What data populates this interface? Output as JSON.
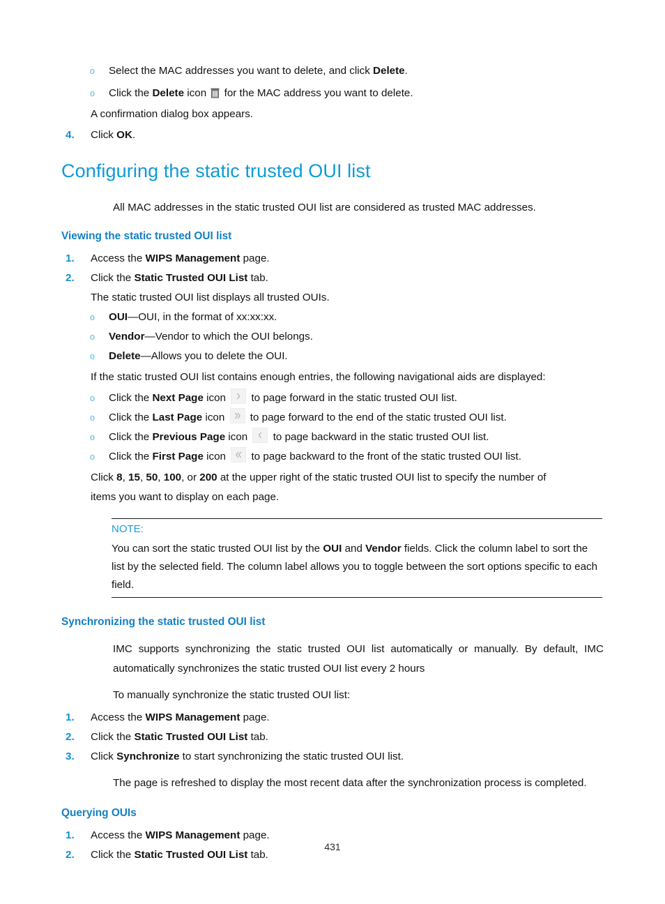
{
  "document": {
    "page_number": "431"
  },
  "top_section": {
    "bullets": [
      {
        "marker": "o",
        "pre": "Select the MAC addresses you want to delete, and click ",
        "bold": "Delete",
        "post": "."
      },
      {
        "marker": "o",
        "pre": "Click the ",
        "bold": "Delete",
        "mid": " icon ",
        "icon": "trash-icon",
        "post": " for the MAC address you want to delete."
      }
    ],
    "confirmation_text": "A confirmation dialog box appears.",
    "step": {
      "num": "4.",
      "pre": "Click ",
      "bold": "OK",
      "post": "."
    }
  },
  "main_heading": "Configuring the static trusted OUI list",
  "intro_paragraph": "All MAC addresses in the static trusted OUI list are considered as trusted MAC addresses.",
  "viewing": {
    "heading": "Viewing the static trusted OUI list",
    "steps": [
      {
        "num": "1.",
        "pre": "Access the ",
        "bold": "WIPS Management",
        "post": " page."
      },
      {
        "num": "2.",
        "pre": "Click the ",
        "bold": "Static Trusted OUI List",
        "post": " tab."
      }
    ],
    "displays_text": "The static trusted OUI list displays all trusted OUIs.",
    "field_bullets": [
      {
        "marker": "o",
        "bold": "OUI",
        "post": "—OUI, in the format of xx:xx:xx."
      },
      {
        "marker": "o",
        "bold": "Vendor",
        "post": "—Vendor to which the OUI belongs."
      },
      {
        "marker": "o",
        "bold": "Delete",
        "post": "—Allows you to delete the OUI."
      }
    ],
    "nav_intro": "If the static trusted OUI list contains enough entries, the following navigational aids are displayed:",
    "nav_bullets": [
      {
        "marker": "o",
        "pre": "Click the ",
        "bold": "Next Page",
        "mid": " icon ",
        "icon": "next-page-icon",
        "post": " to page forward in the static trusted OUI list."
      },
      {
        "marker": "o",
        "pre": "Click the ",
        "bold": "Last Page",
        "mid": " icon ",
        "icon": "last-page-icon",
        "post": " to page forward to the end of the static trusted OUI list."
      },
      {
        "marker": "o",
        "pre": "Click the ",
        "bold": "Previous Page",
        "mid": " icon ",
        "icon": "previous-page-icon",
        "post": " to page backward in the static trusted OUI list."
      },
      {
        "marker": "o",
        "pre": "Click the ",
        "bold": "First Page",
        "mid": " icon ",
        "icon": "first-page-icon",
        "post": " to page backward to the front of the static trusted OUI list."
      }
    ],
    "page_size_text": {
      "pre": "Click ",
      "opt1": "8",
      "sep1": ", ",
      "opt2": "15",
      "sep2": ", ",
      "opt3": "50",
      "sep3": ", ",
      "opt4": "100",
      "sep4": ", or ",
      "opt5": "200",
      "post": " at the upper right of the static trusted OUI list to specify the number of items you want to display on each page."
    }
  },
  "note": {
    "label": "NOTE:",
    "pre": "You can sort the static trusted OUI list by the ",
    "bold1": "OUI",
    "mid": " and ",
    "bold2": "Vendor",
    "post": " fields. Click the column label to sort the list by the selected field. The column label allows you to toggle between the sort options specific to each field."
  },
  "synchronizing": {
    "heading": "Synchronizing the static trusted OUI list",
    "paragraph": "IMC supports synchronizing the static trusted OUI list automatically or manually. By default, IMC automatically synchronizes the static trusted OUI list every 2 hours",
    "manual_intro": "To manually synchronize the static trusted OUI list:",
    "steps": [
      {
        "num": "1.",
        "pre": "Access the ",
        "bold": "WIPS Management",
        "post": " page."
      },
      {
        "num": "2.",
        "pre": "Click the ",
        "bold": "Static Trusted OUI List",
        "post": " tab."
      },
      {
        "num": "3.",
        "pre": "Click ",
        "bold": "Synchronize",
        "post": " to start synchronizing the static trusted OUI list."
      }
    ],
    "refresh_text": "The page is refreshed to display the most recent data after the synchronization process is completed."
  },
  "querying": {
    "heading": "Querying OUIs",
    "steps": [
      {
        "num": "1.",
        "pre": "Access the ",
        "bold": "WIPS Management",
        "post": " page."
      },
      {
        "num": "2.",
        "pre": "Click the ",
        "bold": "Static Trusted OUI List",
        "post": " tab."
      }
    ]
  },
  "colors": {
    "heading_blue": "#0f9ad7",
    "subheading_blue": "#1380c4",
    "number_blue": "#128fd0",
    "bullet_blue": "#4fb8e4",
    "note_blue": "#1a9ad6",
    "text_black": "#131313"
  }
}
